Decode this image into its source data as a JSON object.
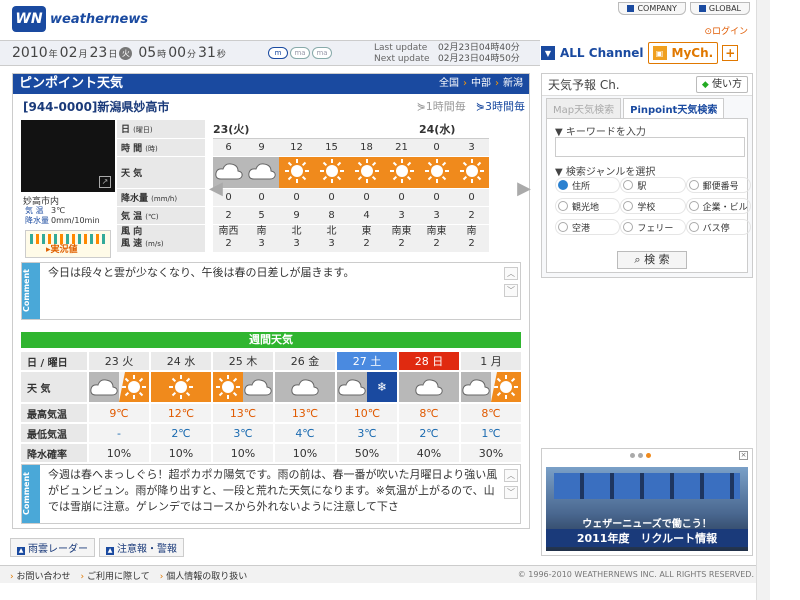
{
  "header": {
    "logo_mark": "WN",
    "logo_text": "weathernews",
    "company": "COMPANY",
    "global": "GLOBAL",
    "login": "ログイン"
  },
  "datebar": {
    "year": "2010",
    "month": "02",
    "day": "23",
    "dow": "火",
    "hour": "05",
    "minute": "00",
    "second": "31",
    "unit_year": "年",
    "unit_month": "月",
    "unit_day": "日",
    "unit_hour": "時",
    "unit_minute": "分",
    "unit_second": "秒",
    "pills": [
      "m",
      "ma",
      "ma"
    ],
    "last_update_label": "Last update",
    "last_update": "02月23日04時40分",
    "next_update_label": "Next update",
    "next_update": "02月23日04時50分"
  },
  "channels": {
    "all": "ALL Channel",
    "my": "MyCh.",
    "plus": "+"
  },
  "pinpoint": {
    "title": "ピンポイント天気",
    "regions": [
      "全国",
      "中部",
      "新潟"
    ],
    "location": "[944-0000]新潟県妙高市",
    "tab_1h": "1時間毎",
    "tab_3h": "3時間毎",
    "place": "妙高市内",
    "obs_temp_label": "気 温",
    "obs_temp": "3℃",
    "obs_rain_label": "降水量",
    "obs_rain": "0mm/10min",
    "obs_button": "実況値",
    "labels": {
      "day": "日",
      "day_sub": "(曜日)",
      "time": "時 間",
      "time_sub": "(時)",
      "weather": "天 気",
      "rain": "降水量",
      "rain_sub": "(mm/h)",
      "temp": "気 温",
      "temp_sub": "(℃)",
      "wind1": "風 向",
      "wind2": "風 速",
      "wind2_sub": "(m/s)"
    },
    "day1": "23(火)",
    "day2": "24(水)",
    "hours": [
      "6",
      "9",
      "12",
      "15",
      "18",
      "21",
      "0",
      "3"
    ],
    "weather": [
      "cloud",
      "cloud",
      "sun",
      "sun",
      "sun",
      "sun",
      "sun",
      "sun"
    ],
    "rain": [
      "0",
      "0",
      "0",
      "0",
      "0",
      "0",
      "0",
      "0"
    ],
    "temp": [
      "2",
      "5",
      "9",
      "8",
      "4",
      "3",
      "3",
      "2"
    ],
    "wind_dir": [
      "南西",
      "南",
      "北",
      "北",
      "東",
      "南東",
      "南東",
      "南"
    ],
    "wind_speed": [
      "2",
      "3",
      "3",
      "3",
      "2",
      "2",
      "2",
      "2"
    ],
    "comment_label": "Comment",
    "comment": "今日は段々と雲が少なくなり、午後は春の日差しが届きます。"
  },
  "weekly": {
    "title": "週間天気",
    "labels": {
      "day": "日 / 曜日",
      "weather": "天 気",
      "max": "最高気温",
      "min": "最低気温",
      "pop": "降水確率"
    },
    "days": [
      "23 火",
      "24 水",
      "25 木",
      "26 金",
      "27 土",
      "28 日",
      "1 月"
    ],
    "icons": [
      "cloud-sun",
      "sun",
      "sun-cloud",
      "cloud",
      "cloud-snow",
      "cloud",
      "cloud-sun"
    ],
    "max": [
      "9℃",
      "12℃",
      "13℃",
      "13℃",
      "10℃",
      "8℃",
      "8℃"
    ],
    "min": [
      "-",
      "2℃",
      "3℃",
      "4℃",
      "3℃",
      "2℃",
      "1℃"
    ],
    "pop": [
      "10%",
      "10%",
      "10%",
      "10%",
      "50%",
      "40%",
      "30%"
    ],
    "comment_label": "Comment",
    "comment": "今週は春へまっしぐら！超ポカポカ陽気です。雨の前は、春一番が吹いた月曜日より強い風がビュンビュン。雨が降り出すと、一段と荒れた天気になります。※気温が上がるので、山では雪崩に注意。ゲレンデではコースから外れないように注意して下さ"
  },
  "bottom_links": [
    "雨雲レーダー",
    "注意報・警報"
  ],
  "right": {
    "title": "天気予報 Ch.",
    "howto": "使い方",
    "tab_map": "Map天気検索",
    "tab_pinpoint": "Pinpoint天気検索",
    "keyword_label": "▼ キーワードを入力",
    "keyword_value": "",
    "genre_label": "▼ 検索ジャンルを選択",
    "genres": [
      "住所",
      "駅",
      "郵便番号",
      "観光地",
      "学校",
      "企業・ビル",
      "空港",
      "フェリー",
      "バス停"
    ],
    "search": "検 索"
  },
  "ad": {
    "line1": "ウェザーニューズで働こう！",
    "line2": "2011年度　リクルート情報"
  },
  "footer": {
    "links": [
      "お問い合わせ",
      "ご利用に際して",
      "個人情報の取り扱い"
    ],
    "copyright": "© 1996-2010 WEATHERNEWS INC. ALL RIGHTS RESERVED."
  },
  "colors": {
    "brand_blue": "#1a4aa0",
    "sun_orange": "#f08a1c",
    "weekly_green": "#2fb52f",
    "saturday": "#4a8ae0",
    "sunday": "#e02a10"
  }
}
